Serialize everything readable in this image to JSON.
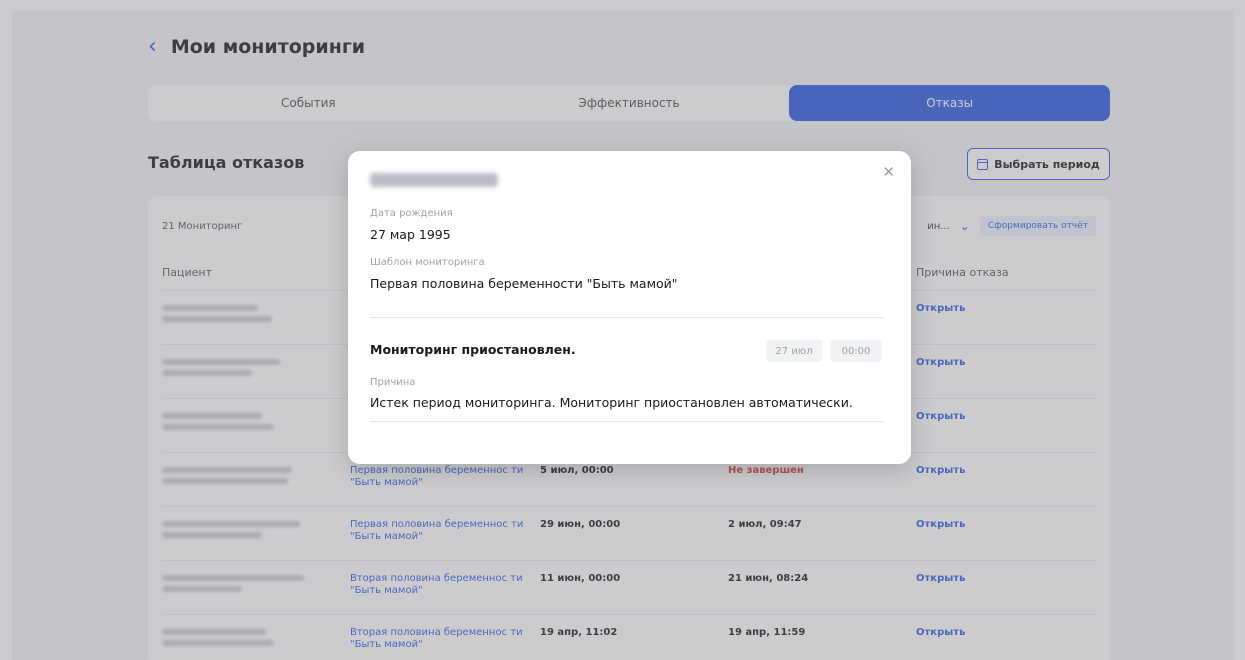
{
  "header": {
    "back_icon": "chevron-left-icon",
    "title": "Мои мониторинги"
  },
  "tabs": [
    {
      "label": "События",
      "active": false
    },
    {
      "label": "Эффективность",
      "active": false
    },
    {
      "label": "Отказы",
      "active": true
    }
  ],
  "section": {
    "title": "Таблица отказов",
    "period_button": "Выбрать период"
  },
  "table": {
    "count_label": "21 Мониторинг",
    "filter_value": "ин...",
    "report_button": "Сформировать отчёт",
    "headers": {
      "patient": "Пациент",
      "reason": "Причина отказа"
    },
    "rows": [
      {
        "template": "",
        "start": "",
        "end": "",
        "action": "Открыть"
      },
      {
        "template": "",
        "start": "",
        "end": "",
        "action": "Открыть"
      },
      {
        "template": "",
        "start": "",
        "end": "",
        "action": "Открыть"
      },
      {
        "template": "Первая половина беременнос ти \"Быть мамой\"",
        "start": "5 июл, 00:00",
        "end": "Не завершен",
        "action": "Открыть"
      },
      {
        "template": "Первая половина беременнос ти \"Быть мамой\"",
        "start": "29 июн, 00:00",
        "end": "2 июл, 09:47",
        "action": "Открыть"
      },
      {
        "template": "Вторая половина беременнос ти \"Быть мамой\"",
        "start": "11 июн, 00:00",
        "end": "21 июн, 08:24",
        "action": "Открыть"
      },
      {
        "template": "Вторая половина беременнос ти \"Быть мамой\"",
        "start": "19 апр, 11:02",
        "end": "19 апр, 11:59",
        "action": "Открыть"
      }
    ]
  },
  "modal": {
    "close_icon": "close-icon",
    "birth_label": "Дата рождения",
    "birth_value": "27 мар 1995",
    "template_label": "Шаблон мониторинга",
    "template_value": "Первая половина беременности \"Быть мамой\"",
    "status": "Мониторинг приостановлен.",
    "date_chip": "27 июл",
    "time_chip": "00:00",
    "reason_label": "Причина",
    "reason_value": "Истек период мониторинга. Мониторинг приостановлен автоматически."
  },
  "colors": {
    "accent": "#2e5be0",
    "error": "#d33a2c"
  }
}
